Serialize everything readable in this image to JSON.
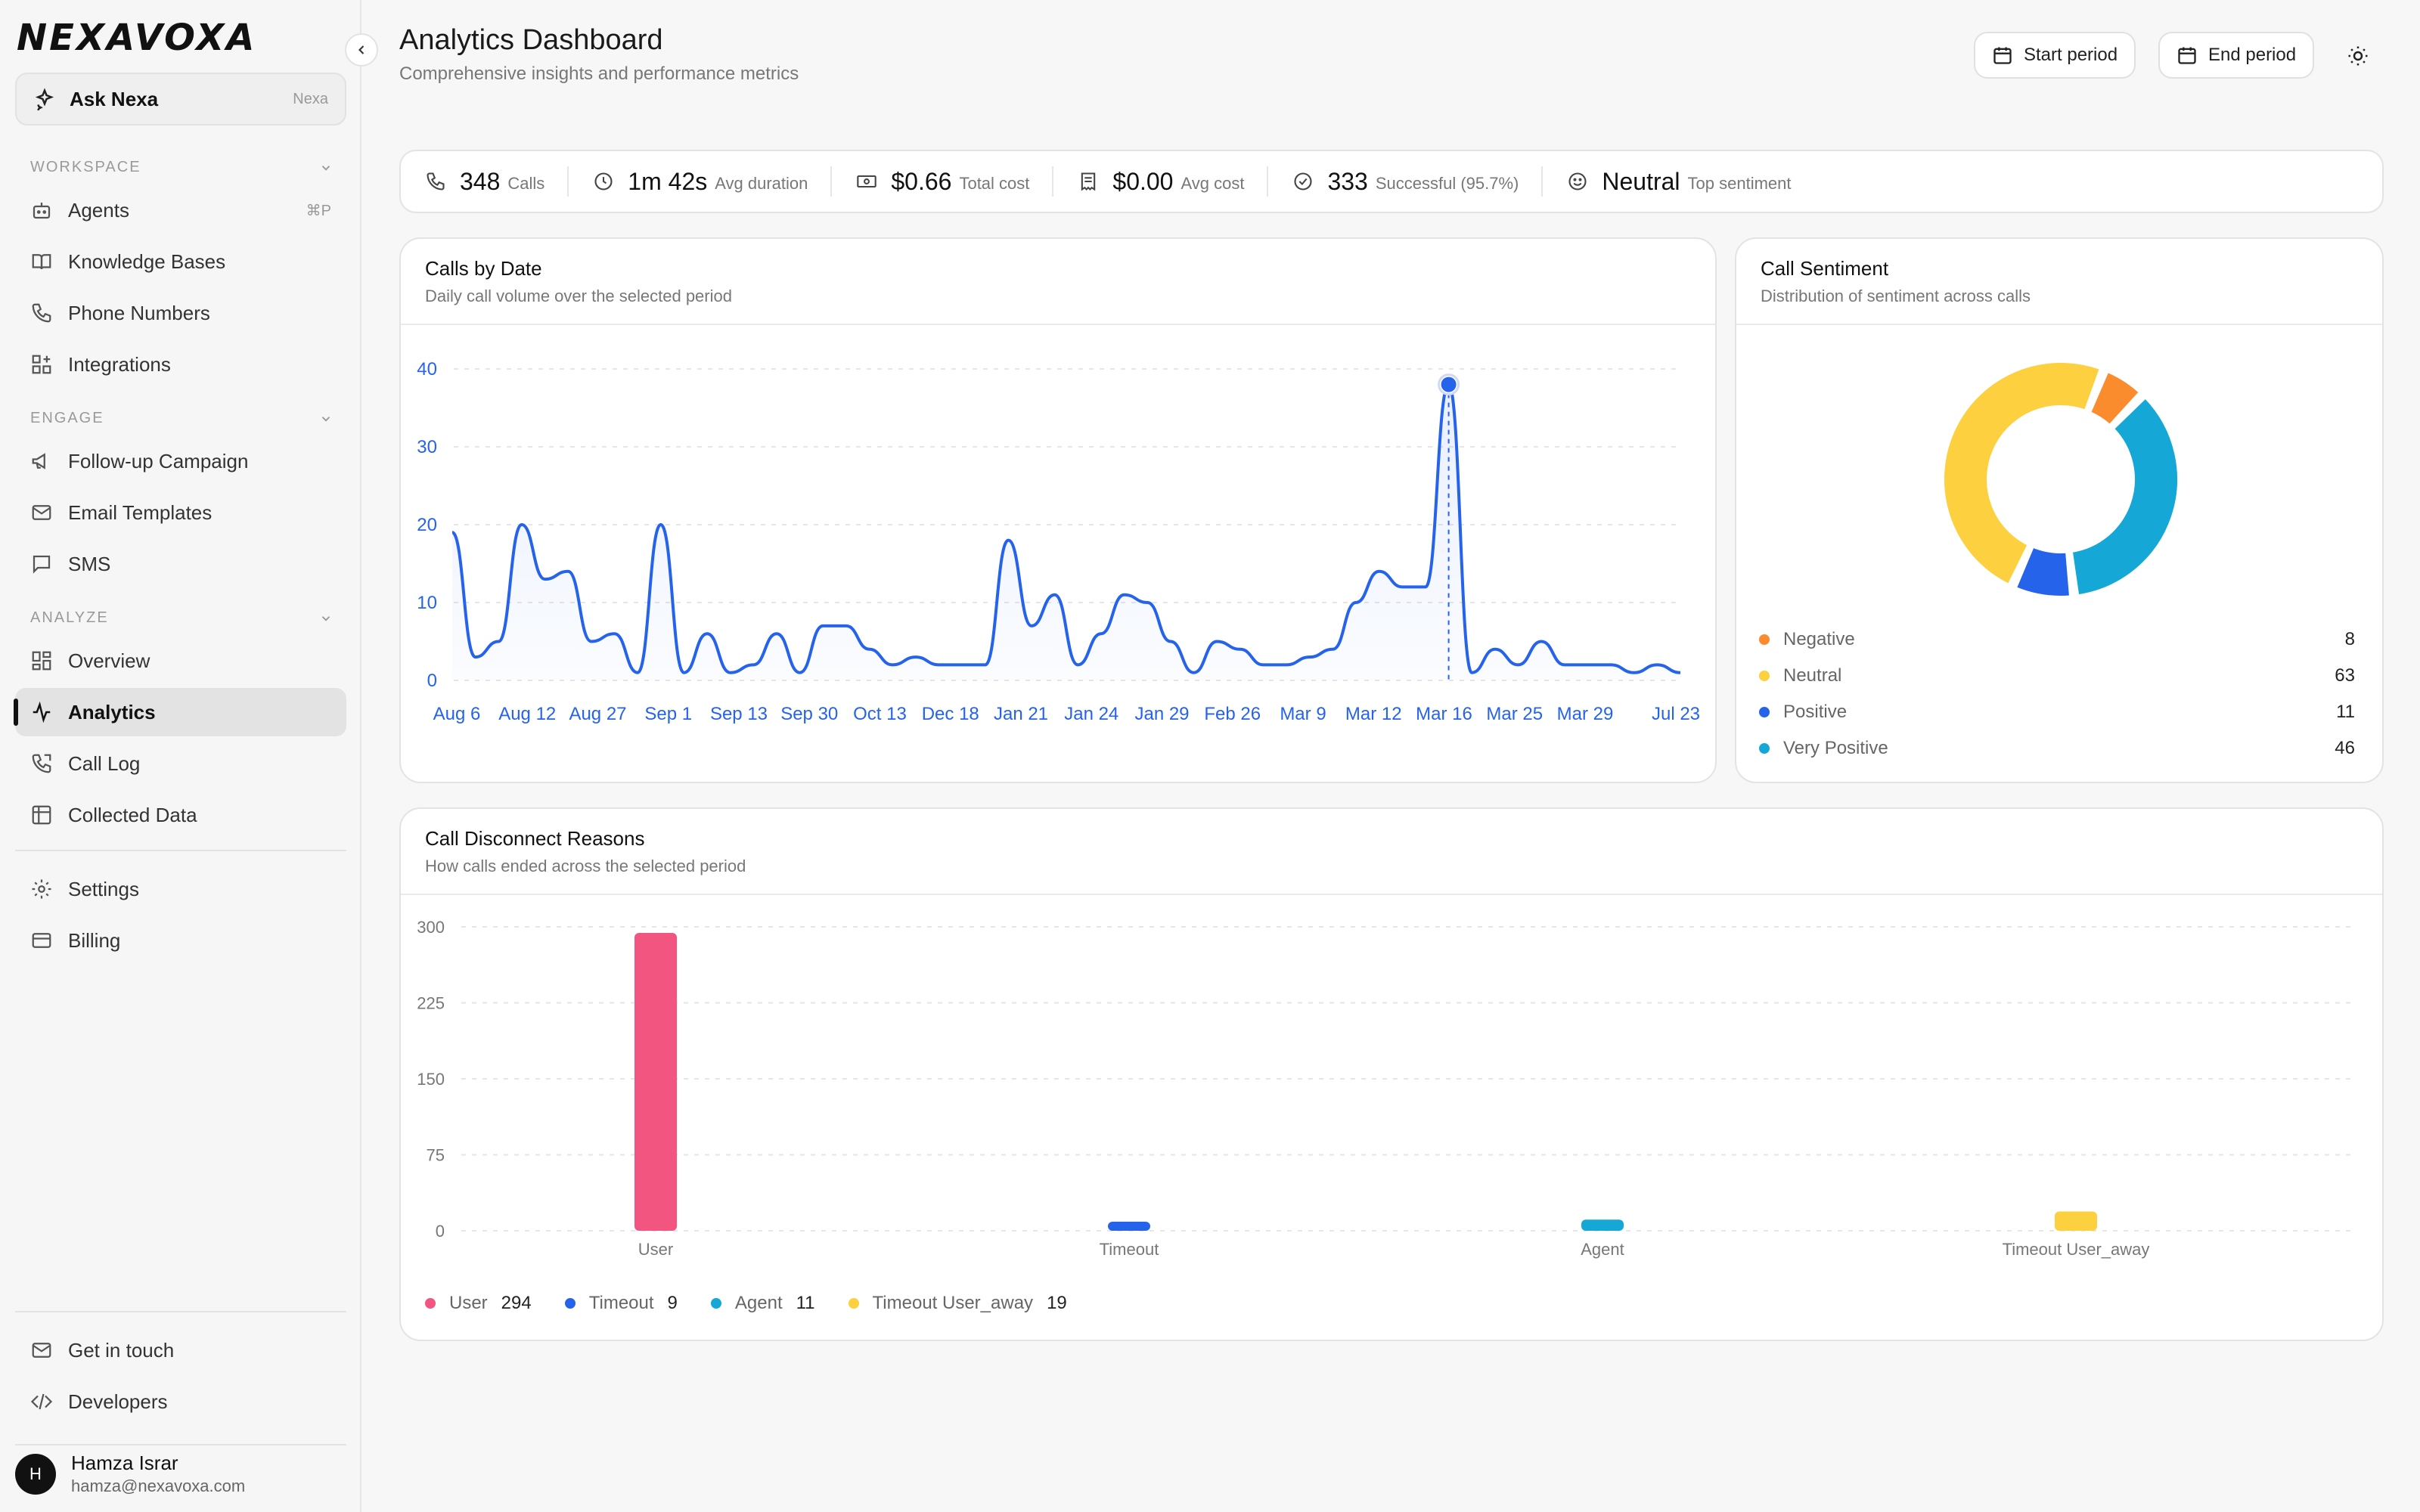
{
  "brand": {
    "logo_text": "NEXAVOXA"
  },
  "ask": {
    "label": "Ask Nexa",
    "hint": "Nexa"
  },
  "sidebar": {
    "sections": [
      {
        "title": "WORKSPACE"
      },
      {
        "title": "ENGAGE"
      },
      {
        "title": "ANALYZE"
      }
    ],
    "items": [
      {
        "label": "Agents",
        "shortcut": "⌘P",
        "icon": "robot-icon"
      },
      {
        "label": "Knowledge Bases",
        "icon": "book-icon"
      },
      {
        "label": "Phone Numbers",
        "icon": "phone-icon"
      },
      {
        "label": "Integrations",
        "icon": "grid-plus-icon"
      },
      {
        "label": "Follow-up Campaign",
        "icon": "megaphone-icon"
      },
      {
        "label": "Email Templates",
        "icon": "mail-icon"
      },
      {
        "label": "SMS",
        "icon": "message-icon"
      },
      {
        "label": "Overview",
        "icon": "dashboard-icon"
      },
      {
        "label": "Analytics",
        "icon": "activity-icon",
        "active": true
      },
      {
        "label": "Call Log",
        "icon": "phone-log-icon"
      },
      {
        "label": "Collected Data",
        "icon": "table-icon"
      },
      {
        "label": "Settings",
        "icon": "gear-icon"
      },
      {
        "label": "Billing",
        "icon": "card-icon"
      },
      {
        "label": "Get in touch",
        "icon": "mail-icon"
      },
      {
        "label": "Developers",
        "icon": "code-icon"
      }
    ]
  },
  "user": {
    "initial": "H",
    "name": "Hamza Israr",
    "email": "hamza@nexavoxa.com"
  },
  "header": {
    "title": "Analytics Dashboard",
    "subtitle": "Comprehensive insights and performance metrics",
    "start_label": "Start period",
    "end_label": "End period"
  },
  "stats": [
    {
      "value": "348",
      "label": "Calls",
      "icon": "phone-icon"
    },
    {
      "value": "1m 42s",
      "label": "Avg duration",
      "icon": "clock-icon"
    },
    {
      "value": "$0.66",
      "label": "Total cost",
      "icon": "banknote-icon"
    },
    {
      "value": "$0.00",
      "label": "Avg cost",
      "icon": "receipt-icon"
    },
    {
      "value": "333",
      "label": "Successful (95.7%)",
      "icon": "check-circle-icon"
    },
    {
      "value": "Neutral",
      "label": "Top sentiment",
      "icon": "smile-icon"
    }
  ],
  "calls_card": {
    "title": "Calls by Date",
    "subtitle": "Daily call volume over the selected period"
  },
  "sentiment_card": {
    "title": "Call Sentiment",
    "subtitle": "Distribution of sentiment across calls"
  },
  "disconnect_card": {
    "title": "Call Disconnect Reasons",
    "subtitle": "How calls ended across the selected period"
  },
  "colors": {
    "line": "#2563eb",
    "negative": "#fb8c2e",
    "neutral": "#fcd03e",
    "positive": "#2563eb",
    "very_positive": "#15a8d6",
    "user": "#f2557f"
  },
  "chart_data": [
    {
      "type": "line",
      "title": "Calls by Date",
      "x_tick_labels": [
        "Aug 6",
        "Aug 12",
        "Aug 27",
        "Sep 1",
        "Sep 13",
        "Sep 30",
        "Oct 13",
        "Dec 18",
        "Jan 21",
        "Jan 24",
        "Jan 29",
        "Feb 26",
        "Mar 9",
        "Mar 12",
        "Mar 16",
        "Mar 25",
        "Mar 29",
        "Jul 23"
      ],
      "y_ticks": [
        0,
        10,
        20,
        30,
        40
      ],
      "ylim": [
        0,
        40
      ],
      "values": [
        19,
        3,
        5,
        20,
        13,
        14,
        5,
        6,
        1,
        20,
        1,
        6,
        1,
        2,
        6,
        1,
        7,
        7,
        4,
        2,
        3,
        2,
        2,
        2,
        18,
        7,
        11,
        2,
        6,
        11,
        10,
        5,
        1,
        5,
        4,
        2,
        2,
        3,
        4,
        10,
        14,
        12,
        12,
        38,
        1,
        4,
        2,
        5,
        2,
        2,
        2,
        1,
        2,
        1
      ],
      "highlight_value": 38,
      "grid": true
    },
    {
      "type": "pie",
      "title": "Call Sentiment",
      "categories": [
        "Negative",
        "Neutral",
        "Positive",
        "Very Positive"
      ],
      "values": [
        8,
        63,
        11,
        46
      ]
    },
    {
      "type": "bar",
      "title": "Call Disconnect Reasons",
      "categories": [
        "User",
        "Timeout",
        "Agent",
        "Timeout User_away"
      ],
      "values": [
        294,
        9,
        11,
        19
      ],
      "y_tick_labels": [
        "300",
        "225",
        "150",
        "75",
        "0"
      ],
      "ylim": [
        0,
        300
      ],
      "grid": true
    }
  ]
}
